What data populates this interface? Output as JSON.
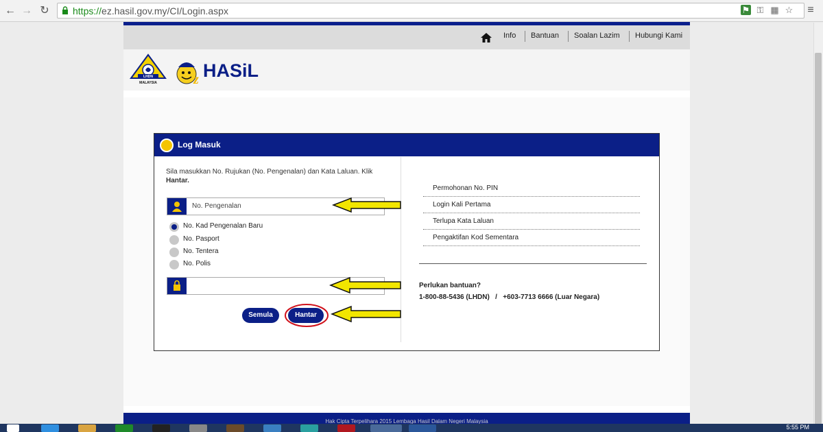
{
  "browser": {
    "url_scheme": "https://",
    "url_rest": "ez.hasil.gov.my/CI/Login.aspx"
  },
  "site": {
    "nav": {
      "info": "Info",
      "bantuan": "Bantuan",
      "soalan": "Soalan Lazim",
      "hubungi": "Hubungi Kami"
    },
    "logos": {
      "lhdn_text": "LHDN",
      "malaysia_text": "MALAYSIA",
      "ezhasil_text": "HASiL",
      "ez_prefix": "ez"
    },
    "panel": {
      "title": "Log Masuk",
      "instruction_main": "Sila masukkan No. Rujukan (No. Pengenalan) dan Kata Laluan. Klik",
      "instruction_bold": "Hantar.",
      "id_placeholder": "No. Pengenalan",
      "id_types": [
        {
          "label": "No. Kad Pengenalan Baru",
          "selected": true
        },
        {
          "label": "No. Pasport",
          "selected": false
        },
        {
          "label": "No. Tentera",
          "selected": false
        },
        {
          "label": "No. Polis",
          "selected": false
        }
      ],
      "reset_button": "Semula",
      "submit_button": "Hantar"
    },
    "links": [
      "Permohonan No. PIN",
      "Login Kali Pertama",
      "Terlupa Kata Laluan",
      "Pengaktifan Kod Sementara"
    ],
    "help": {
      "title": "Perlukan bantuan?",
      "phones": "1-800-88-5436 (LHDN)   /   +603-7713 6666 (Luar Negara)"
    },
    "footer": "Hak Cipta Terpelihara 2015 Lembaga Hasil Dalam Negeri Malaysia"
  },
  "taskbar": {
    "clock": "5:55 PM"
  },
  "colors": {
    "brand_blue": "#0b1f87",
    "arrow_yellow": "#f2e600",
    "highlight_red": "#d0101a"
  }
}
